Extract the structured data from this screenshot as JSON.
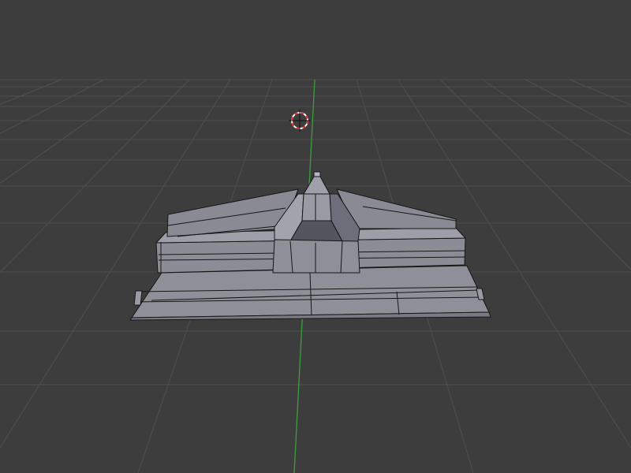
{
  "app": {
    "editor": "3D Viewport",
    "view": "perspective"
  },
  "viewport": {
    "background_color": "#3d3d3d",
    "grid_color": "#4f4f4f",
    "y_axis_color": "#3f9c3f",
    "show_grid": true,
    "show_axes": true
  },
  "cursor_3d": {
    "icon": "3d-cursor-icon",
    "ring_colors": [
      "#e03030",
      "#ffffff"
    ],
    "crosshair_color": "#111111"
  },
  "object": {
    "type": "mesh",
    "shading": "solid",
    "wireframe_overlay": true,
    "face_color": "#8e8e98",
    "face_dark_color": "#646470",
    "face_light_color": "#a4a4ae",
    "edge_color": "#161616"
  }
}
